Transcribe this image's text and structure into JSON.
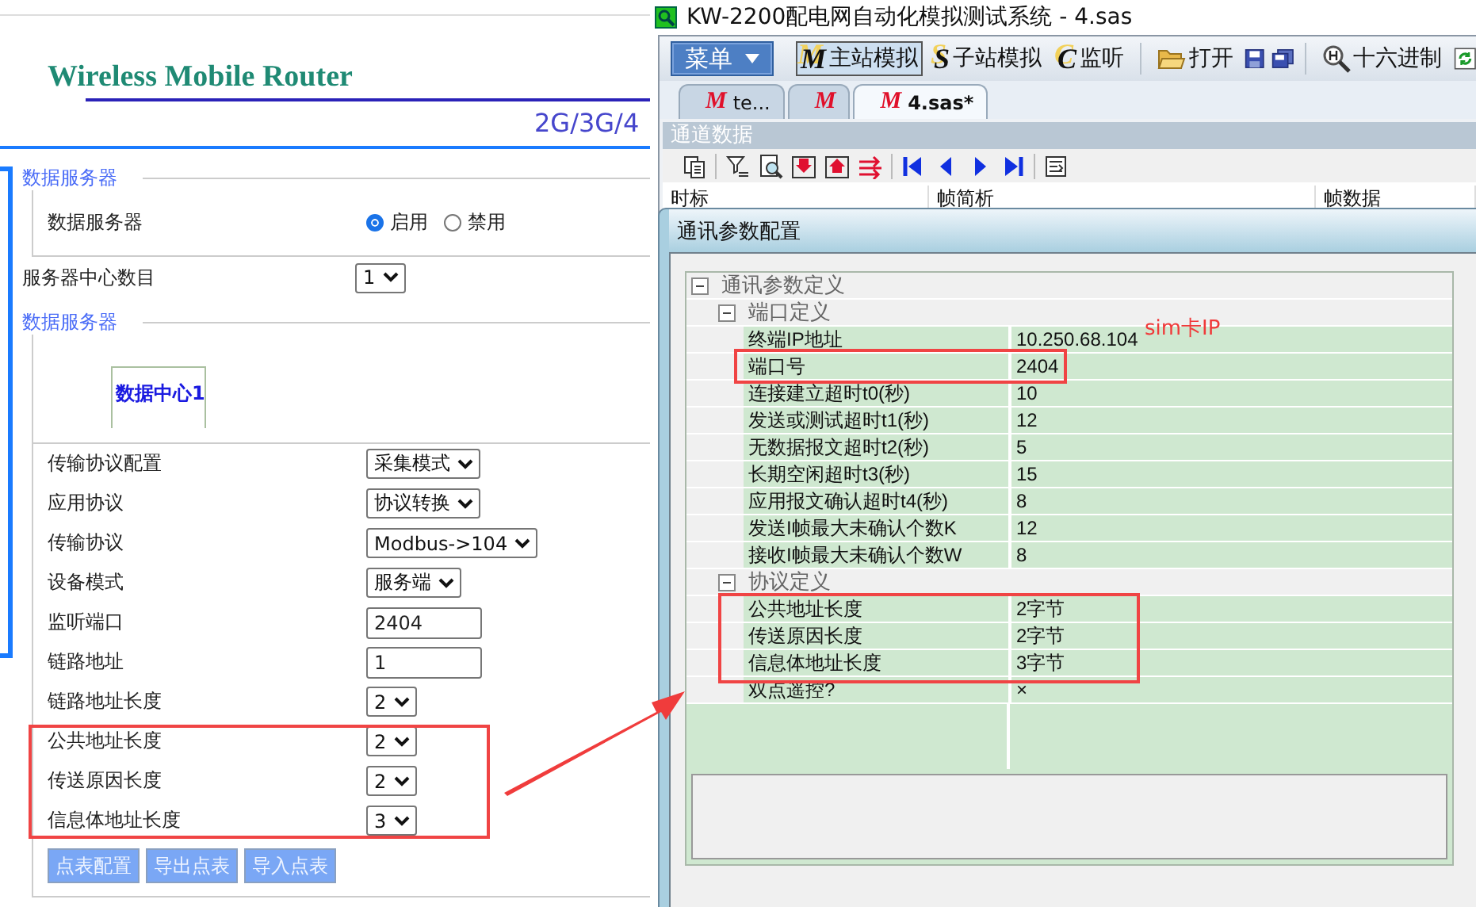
{
  "router_page": {
    "title": "Wireless Mobile Router",
    "subtitle": "2G/3G/4",
    "server": {
      "legend": "数据服务器",
      "label": "数据服务器",
      "options": [
        {
          "label": "启用",
          "selected": true
        },
        {
          "label": "禁用",
          "selected": false
        }
      ]
    },
    "center_count": {
      "label": "服务器中心数目",
      "value": "1"
    },
    "centers": {
      "legend": "数据服务器",
      "tabs": [
        {
          "label": "数据中心1",
          "selected": true
        }
      ]
    },
    "fields": [
      {
        "label": "传输协议配置",
        "kind": "select",
        "value": "采集模式"
      },
      {
        "label": "应用协议",
        "kind": "select",
        "value": "协议转换"
      },
      {
        "label": "传输协议",
        "kind": "select",
        "value": "Modbus->104"
      },
      {
        "label": "设备模式",
        "kind": "select",
        "value": "服务端"
      },
      {
        "label": "监听端口",
        "kind": "input",
        "value": "2404"
      },
      {
        "label": "链路地址",
        "kind": "input",
        "value": "1"
      },
      {
        "label": "链路地址长度",
        "kind": "select",
        "value": "2"
      },
      {
        "label": "公共地址长度",
        "kind": "select",
        "value": "2"
      },
      {
        "label": "传送原因长度",
        "kind": "select",
        "value": "2"
      },
      {
        "label": "信息体地址长度",
        "kind": "select",
        "value": "3"
      }
    ],
    "buttons": [
      "点表配置",
      "导出点表",
      "导入点表"
    ]
  },
  "app_window": {
    "title": "KW-2200配电网自动化模拟测试系统 - 4.sas",
    "menu_button": "菜单",
    "toolbar": [
      {
        "kind": "mode",
        "glyph": "M",
        "label": "主站模拟",
        "pressed": true
      },
      {
        "kind": "mode",
        "glyph": "S",
        "label": "子站模拟",
        "pressed": false
      },
      {
        "kind": "mode",
        "glyph": "C",
        "label": "监听",
        "pressed": false
      },
      {
        "kind": "separator"
      },
      {
        "kind": "open",
        "label": "打开"
      },
      {
        "kind": "save"
      },
      {
        "kind": "saveall"
      },
      {
        "kind": "separator"
      },
      {
        "kind": "hex",
        "label": "十六进制"
      },
      {
        "kind": "refresh"
      }
    ],
    "tabs": [
      {
        "glyph": "M",
        "label": "te...",
        "selected": false
      },
      {
        "glyph": "M",
        "selected": false
      },
      {
        "glyph": "M",
        "label": "4.sas*",
        "selected": true
      }
    ],
    "panel": {
      "title": "通道数据",
      "columns": [
        "时标",
        "帧简析",
        "帧数据"
      ]
    }
  },
  "dialog": {
    "title": "通讯参数配置",
    "tree": [
      {
        "label": "通讯参数定义",
        "expanded": true,
        "children": [
          {
            "label": "端口定义",
            "expanded": true,
            "children": [
              {
                "name": "终端IP地址",
                "value": "10.250.68.104"
              },
              {
                "name": "端口号",
                "value": "2404"
              },
              {
                "name": "连接建立超时t0(秒)",
                "value": "10"
              },
              {
                "name": "发送或测试超时t1(秒)",
                "value": "12"
              },
              {
                "name": "无数据报文超时t2(秒)",
                "value": "5"
              },
              {
                "name": "长期空闲超时t3(秒)",
                "value": "15"
              },
              {
                "name": "应用报文确认超时t4(秒)",
                "value": "8"
              },
              {
                "name": "发送I帧最大未确认个数K",
                "value": "12"
              },
              {
                "name": "接收I帧最大未确认个数W",
                "value": "8"
              }
            ]
          },
          {
            "label": "协议定义",
            "expanded": true,
            "children": [
              {
                "name": "公共地址长度",
                "value": "2字节"
              },
              {
                "name": "传送原因长度",
                "value": "2字节"
              },
              {
                "name": "信息体地址长度",
                "value": "3字节"
              },
              {
                "name": "双点遥控?",
                "value": "×"
              }
            ]
          }
        ]
      }
    ]
  },
  "annotation": {
    "text": "sim卡IP"
  }
}
